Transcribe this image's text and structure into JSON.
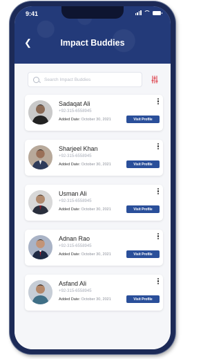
{
  "status_bar": {
    "time": "9:41"
  },
  "header": {
    "title": "Impact Buddies"
  },
  "search": {
    "placeholder": "Search Impact Buddies"
  },
  "buddies": [
    {
      "name": "Sadaqat Ali",
      "phone": "+92-315-6558945",
      "added_label": "Added Date:",
      "added_date": "October 30, 2021",
      "action": "Visit Profile"
    },
    {
      "name": "Sharjeel Khan",
      "phone": "+92-315-6558945",
      "added_label": "Added Date:",
      "added_date": "October 30, 2021",
      "action": "Visit Profile"
    },
    {
      "name": "Usman Ali",
      "phone": "+92-315-6558945",
      "added_label": "Added Date:",
      "added_date": "October 30, 2021",
      "action": "Visit Profile"
    },
    {
      "name": "Adnan Rao",
      "phone": "+92-315-6558945",
      "added_label": "Added Date:",
      "added_date": "October 30, 2021",
      "action": "Visit Profile"
    },
    {
      "name": "Asfand Ali",
      "phone": "+92-315-6558945",
      "added_label": "Added Date:",
      "added_date": "October 30, 2021",
      "action": "Visit Profile"
    }
  ],
  "colors": {
    "header_bg": "#233a79",
    "button_bg": "#2a4f9a",
    "filter_icon": "#e0505a"
  }
}
